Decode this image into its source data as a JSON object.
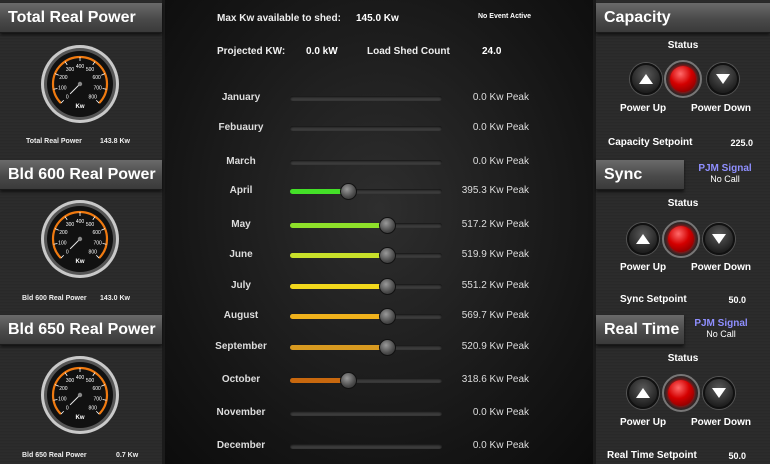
{
  "left": {
    "gauges": [
      {
        "title": "Total Real Power",
        "caption": "Total Real Power",
        "value_text": "143.8 Kw",
        "unit": "Kw"
      },
      {
        "title": "Bld 600 Real Power",
        "caption": "Bld 600 Real Power",
        "value_text": "143.0 Kw",
        "unit": "Kw"
      },
      {
        "title": "Bld 650 Real Power",
        "caption": "Bld 650 Real Power",
        "value_text": "0.7 Kw",
        "unit": "Kw"
      }
    ],
    "ticks": [
      "0",
      "100",
      "200",
      "300",
      "400",
      "500",
      "600",
      "700",
      "800"
    ]
  },
  "center": {
    "max_kw_label": "Max Kw available to shed:",
    "max_kw_value": "145.0 Kw",
    "event_status": "No Event Active",
    "projected_label": "Projected KW:",
    "projected_value": "0.0 kW",
    "shed_count_label": "Load Shed Count",
    "shed_count_value": "24.0",
    "months": [
      {
        "name": "January",
        "peak": "0.0 Kw Peak",
        "level": 0,
        "color": ""
      },
      {
        "name": "Febuaury",
        "peak": "0.0 Kw Peak",
        "level": 0,
        "color": ""
      },
      {
        "name": "March",
        "peak": "0.0 Kw Peak",
        "level": 0,
        "color": ""
      },
      {
        "name": "April",
        "peak": "395.3 Kw Peak",
        "level": 0.38,
        "color": "#44e028"
      },
      {
        "name": "May",
        "peak": "517.2 Kw Peak",
        "level": 0.64,
        "color": "#8ee02a"
      },
      {
        "name": "June",
        "peak": "519.9 Kw Peak",
        "level": 0.64,
        "color": "#c8e02a"
      },
      {
        "name": "July",
        "peak": "551.2 Kw Peak",
        "level": 0.64,
        "color": "#f2d81c"
      },
      {
        "name": "August",
        "peak": "569.7 Kw Peak",
        "level": 0.64,
        "color": "#f0b21c"
      },
      {
        "name": "September",
        "peak": "520.9 Kw Peak",
        "level": 0.64,
        "color": "#d89a20"
      },
      {
        "name": "October",
        "peak": "318.6 Kw Peak",
        "level": 0.38,
        "color": "#c8680e"
      },
      {
        "name": "November",
        "peak": "0.0 Kw Peak",
        "level": 0,
        "color": ""
      },
      {
        "name": "December",
        "peak": "0.0 Kw Peak",
        "level": 0,
        "color": ""
      }
    ]
  },
  "right": {
    "sections": [
      {
        "title": "Capacity",
        "status": "Status",
        "up": "Power Up",
        "down": "Power Down",
        "setpoint_label": "Capacity Setpoint",
        "setpoint_value": "225.0",
        "pjm_signal": "",
        "pjm_call": ""
      },
      {
        "title": "Sync",
        "status": "Status",
        "up": "Power Up",
        "down": "Power Down",
        "setpoint_label": "Sync Setpoint",
        "setpoint_value": "50.0",
        "pjm_signal": "PJM Signal",
        "pjm_call": "No Call"
      },
      {
        "title": "Real Time",
        "status": "Status",
        "up": "Power Up",
        "down": "Power Down",
        "setpoint_label": "Real Time Setpoint",
        "setpoint_value": "50.0",
        "pjm_signal": "PJM Signal",
        "pjm_call": "No Call"
      }
    ]
  },
  "colors": {
    "accent_orange": "#f07a10",
    "status_red": "#d40000",
    "pjm_blue": "#8f8fff"
  }
}
